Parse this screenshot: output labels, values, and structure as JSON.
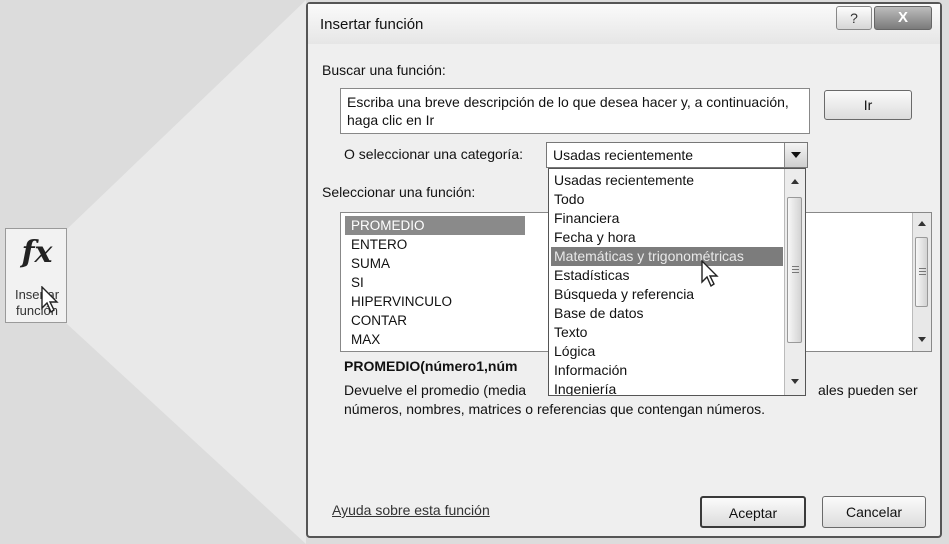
{
  "ribbon_button": {
    "icon": "fx-icon",
    "label_line1": "Insertar",
    "label_line2": "función"
  },
  "dialog": {
    "title": "Insertar función",
    "help_button": "?",
    "close_button": "X",
    "search_label": "Buscar una función:",
    "search_text": "Escriba una breve descripción de lo que desea hacer y, a continuación, haga clic en Ir",
    "go_button": "Ir",
    "category_label": "O seleccionar una categoría:",
    "category_value": "Usadas recientemente",
    "function_label": "Seleccionar una función:",
    "functions": [
      "PROMEDIO",
      "ENTERO",
      "SUMA",
      "SI",
      "HIPERVINCULO",
      "CONTAR",
      "MAX"
    ],
    "selected_function": "PROMEDIO",
    "syntax": "PROMEDIO(número1,núm",
    "description_line1": "Devuelve el promedio (media",
    "description_line1_end": "ales pueden ser",
    "description_line2": "números, nombres, matrices o referencias que contengan números.",
    "help_link": "Ayuda sobre esta función",
    "ok_button": "Aceptar",
    "cancel_button": "Cancelar"
  },
  "category_dropdown": {
    "items": [
      "Usadas recientemente",
      "Todo",
      "Financiera",
      "Fecha y hora",
      "Matemáticas y trigonométricas",
      "Estadísticas",
      "Búsqueda y referencia",
      "Base de datos",
      "Texto",
      "Lógica",
      "Información",
      "Ingeniería"
    ],
    "highlighted": "Matemáticas y trigonométricas"
  }
}
